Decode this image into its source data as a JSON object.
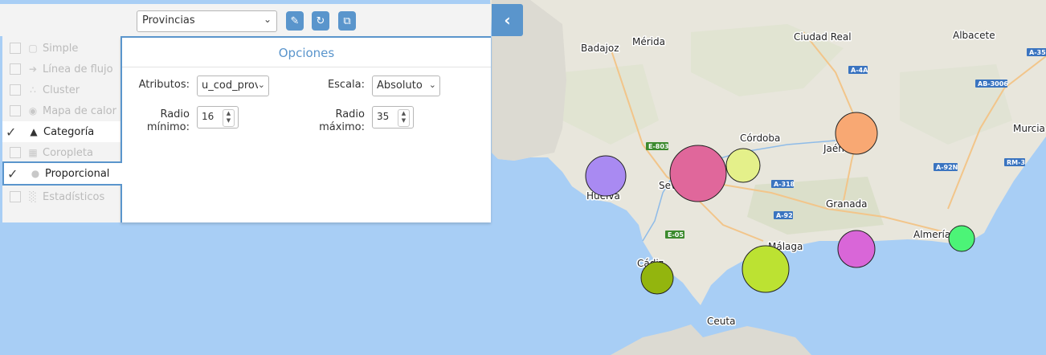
{
  "toolbar": {
    "layer_select": "Provincias",
    "buttons": [
      "brush-icon",
      "reset-icon",
      "copy-icon"
    ],
    "collapse_icon": "chevron-left-icon"
  },
  "sidebar": {
    "items": [
      {
        "label": "Simple",
        "icon": "simple-icon",
        "state": "disabled"
      },
      {
        "label": "Línea de flujo",
        "icon": "arrow-icon",
        "state": "disabled"
      },
      {
        "label": "Cluster",
        "icon": "cluster-icon",
        "state": "disabled"
      },
      {
        "label": "Mapa de calor",
        "icon": "heatmap-icon",
        "state": "disabled"
      },
      {
        "label": "Categoría",
        "icon": "category-icon",
        "state": "checked"
      },
      {
        "label": "Coropleta",
        "icon": "choropleth-icon",
        "state": "disabled"
      },
      {
        "label": "Proporcional",
        "icon": "proportional-icon",
        "state": "selected"
      },
      {
        "label": "Estadísticos",
        "icon": "stats-icon",
        "state": "disabled"
      }
    ]
  },
  "panel": {
    "title": "Opciones",
    "atributos_label": "Atributos:",
    "atributos_value": "u_cod_prov",
    "escala_label": "Escala:",
    "escala_value": "Absoluto",
    "radio_min_label": "Radio mínimo:",
    "radio_min_value": "16",
    "radio_max_label": "Radio máximo:",
    "radio_max_value": "35"
  },
  "map": {
    "places": [
      "Mérida",
      "Badajoz",
      "Ciudad Real",
      "Albacete",
      "Córdoba",
      "Jaén",
      "Murcia",
      "Huelva",
      "Sevilla",
      "Granada",
      "Málaga",
      "Almería",
      "Cádiz",
      "Ceuta"
    ],
    "road_signs": [
      "E-803",
      "A-4A",
      "AB-3006",
      "A-318",
      "A-92",
      "E-05",
      "A-92N",
      "RM-3",
      "A-35"
    ],
    "colors": {
      "sea": "#a8cef5",
      "land": "#e8e6dc",
      "accent": "#5a95cc"
    },
    "symbols": [
      {
        "name": "huelva",
        "color": "#a98af2"
      },
      {
        "name": "sevilla",
        "color": "#e0679b"
      },
      {
        "name": "cordoba",
        "color": "#e4f08a"
      },
      {
        "name": "jaen",
        "color": "#f8a873"
      },
      {
        "name": "malaga",
        "color": "#bce232"
      },
      {
        "name": "granada",
        "color": "#d966d8"
      },
      {
        "name": "almeria",
        "color": "#4cf477"
      },
      {
        "name": "cadiz",
        "color": "#93b50e"
      }
    ]
  }
}
